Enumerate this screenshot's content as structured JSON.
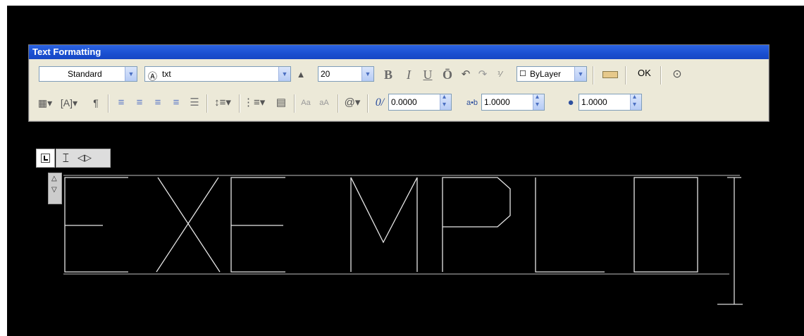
{
  "toolbar": {
    "title": "Text Formatting",
    "style_select": "Standard",
    "font_select": "txt",
    "font_height": "20",
    "bold": "B",
    "italic": "I",
    "underline": "U",
    "overline": "Ō",
    "color_select": "ByLayer",
    "ok_label": "OK",
    "oblique_value": "0.0000",
    "tracking_value": "1.0000",
    "width_value": "1.0000"
  },
  "canvas_text": "EXEMPLO",
  "icons": [
    "columns-icon",
    "justify-icon",
    "paragraph-icon",
    "align-left-icon",
    "align-center-icon",
    "align-right-icon",
    "align-justify-icon",
    "distribute-icon",
    "line-spacing-icon",
    "numbering-icon",
    "field-icon",
    "uppercase-icon",
    "lowercase-icon",
    "symbol-icon",
    "oblique-icon",
    "tracking-icon",
    "width-factor-icon",
    "undo-icon",
    "redo-icon",
    "stack-icon",
    "ruler-icon",
    "options-icon"
  ]
}
